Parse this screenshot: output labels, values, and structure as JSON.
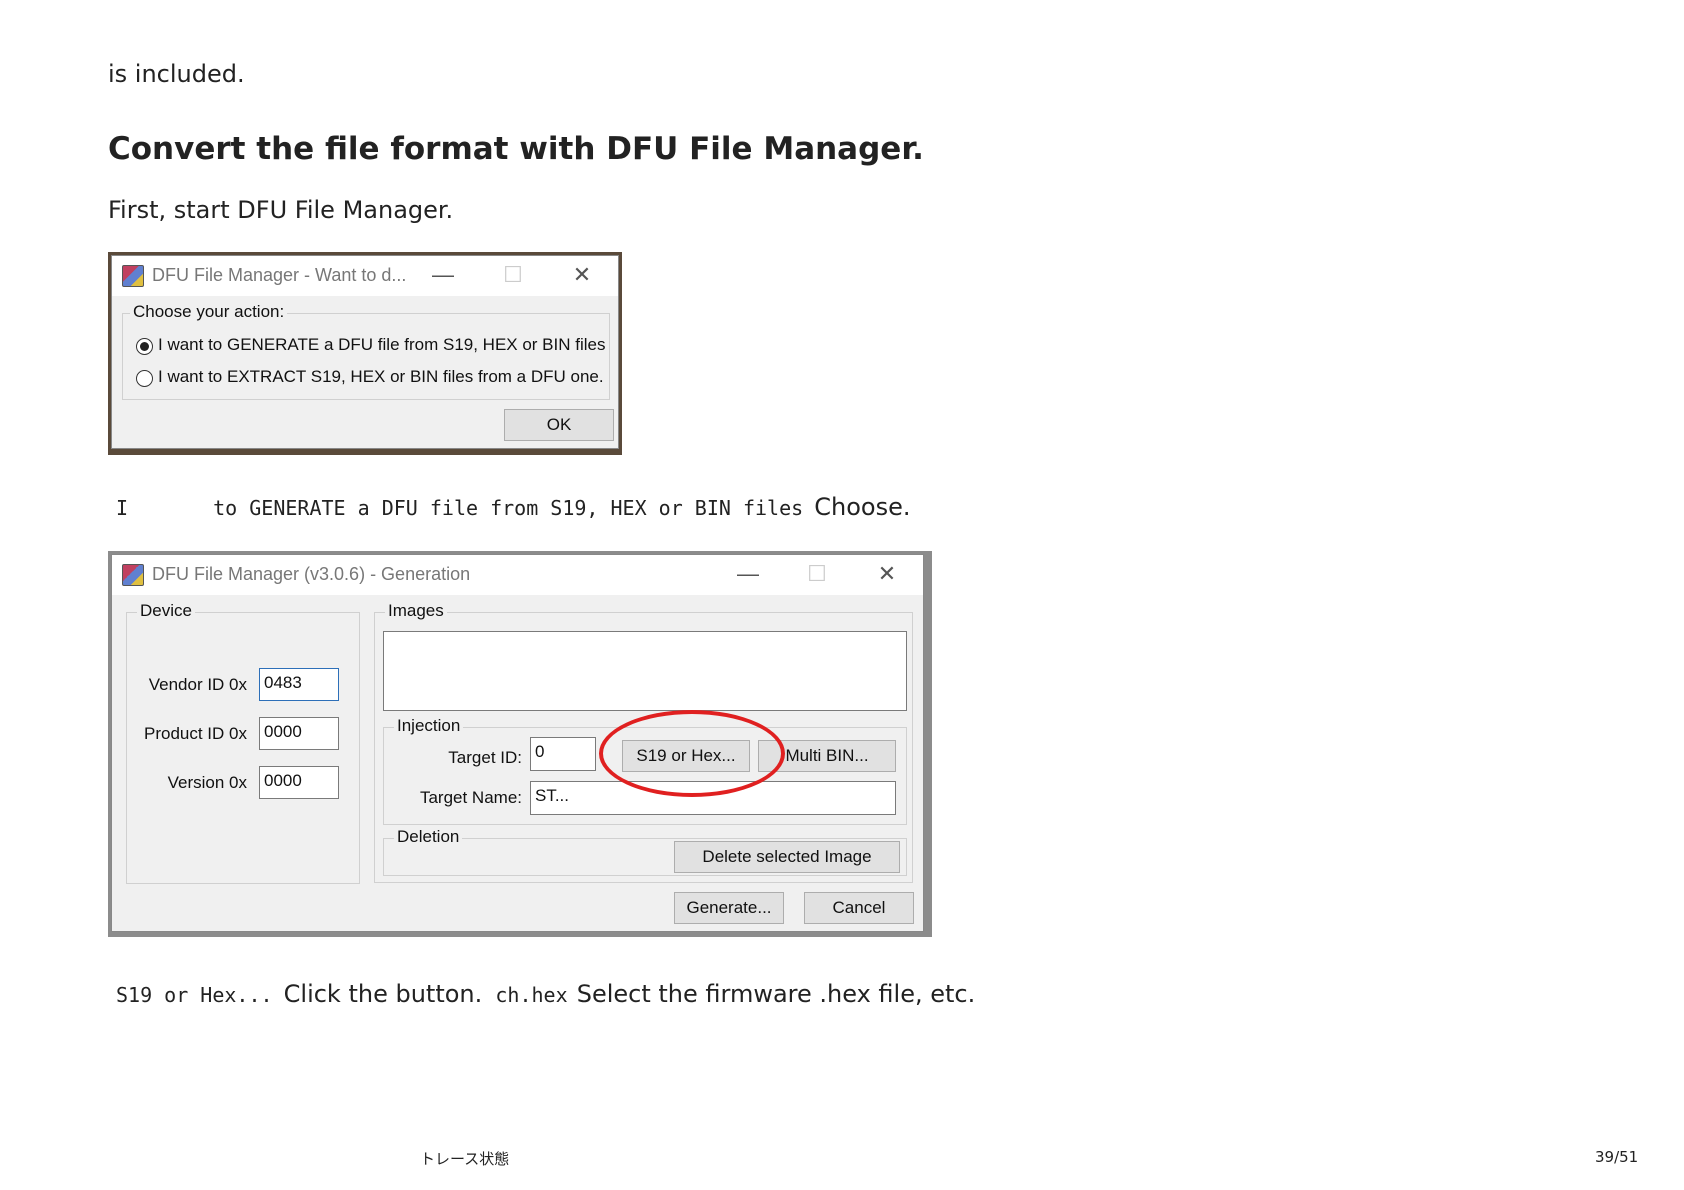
{
  "text": {
    "intro": "is included.",
    "heading": "Convert the file format with DFU File Manager.",
    "step1": "First, start DFU File Manager.",
    "step2_code1": "I",
    "step2_code2": "to GENERATE a DFU file from S19, HEX or BIN files",
    "step2_text": "Choose.",
    "step3_code1": "S19 or Hex...",
    "step3_text1": "Click the button.",
    "step3_code2": "ch.hex",
    "step3_text2": "Select the firmware .hex file, etc."
  },
  "dialog1": {
    "title": "DFU File Manager - Want to d...",
    "group_label": "Choose your action:",
    "option_generate": "I want to GENERATE a DFU file from S19, HEX or BIN files",
    "option_extract": "I want to EXTRACT S19, HEX or BIN files from a DFU one.",
    "selected": "generate",
    "ok_label": "OK"
  },
  "dialog2": {
    "title": "DFU File Manager (v3.0.6) - Generation",
    "device": {
      "label": "Device",
      "vendor_label": "Vendor ID 0x",
      "vendor_value": "0483",
      "product_label": "Product ID 0x",
      "product_value": "0000",
      "version_label": "Version 0x",
      "version_value": "0000"
    },
    "images_label": "Images",
    "injection": {
      "label": "Injection",
      "target_id_label": "Target ID:",
      "target_id_value": "0",
      "target_name_label": "Target Name:",
      "target_name_value": "ST...",
      "s19_button": "S19 or Hex...",
      "multi_bin_button": "Multi BIN..."
    },
    "deletion": {
      "label": "Deletion",
      "delete_button": "Delete selected Image"
    },
    "generate_button": "Generate...",
    "cancel_button": "Cancel"
  },
  "footer": {
    "status": "トレース状態",
    "page": "39/51"
  },
  "colors": {
    "highlight_circle": "#e02020",
    "text": "#222222"
  },
  "icons": {
    "app": "dfu-app-icon",
    "minimize": "minimize-icon",
    "maximize": "maximize-icon",
    "close": "close-icon"
  }
}
